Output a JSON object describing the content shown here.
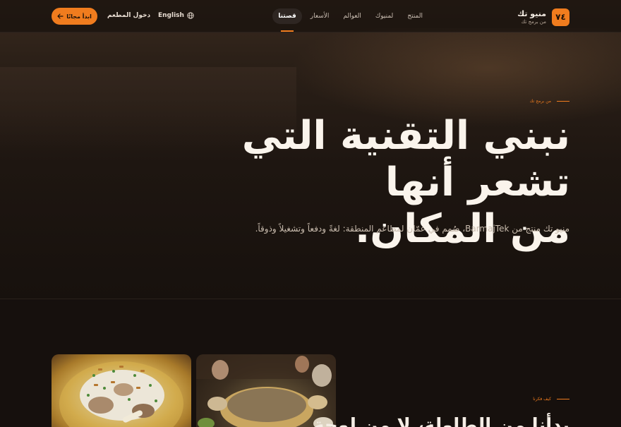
{
  "brand": {
    "name": "منيو تك",
    "tagline": "من برمج تك",
    "logo_glyph": "۷٤",
    "logo_color": "#f07c1e"
  },
  "nav": {
    "links": [
      {
        "label": "المنتج"
      },
      {
        "label": "لمنيوك"
      },
      {
        "label": "العوالم"
      },
      {
        "label": "الأسعار"
      },
      {
        "label": "قصتنا",
        "active": true
      }
    ]
  },
  "header_actions": {
    "language_label": "English",
    "language_icon": "globe-icon",
    "login_label": "دخول المطعم",
    "cta_label": "ابدأ مجانًا",
    "cta_icon": "arrow-left-icon"
  },
  "hero": {
    "eyebrow": "من برمج تك",
    "headline_line1": "نبني التقنية التي تشعر أنها",
    "headline_line2": "من المكان.",
    "subtitle": "منيو تك منتج من BarmajTek، صُمم في عمّان لمطاعم المنطقة: لغةً ودفعاً وتشغيلاً وذوقاً."
  },
  "story": {
    "eyebrow": "كيف فكرنا",
    "title": "بدأنا من الطاولة، لا من لوحة"
  },
  "colors": {
    "accent": "#f07c1e",
    "background": "#16100d"
  }
}
